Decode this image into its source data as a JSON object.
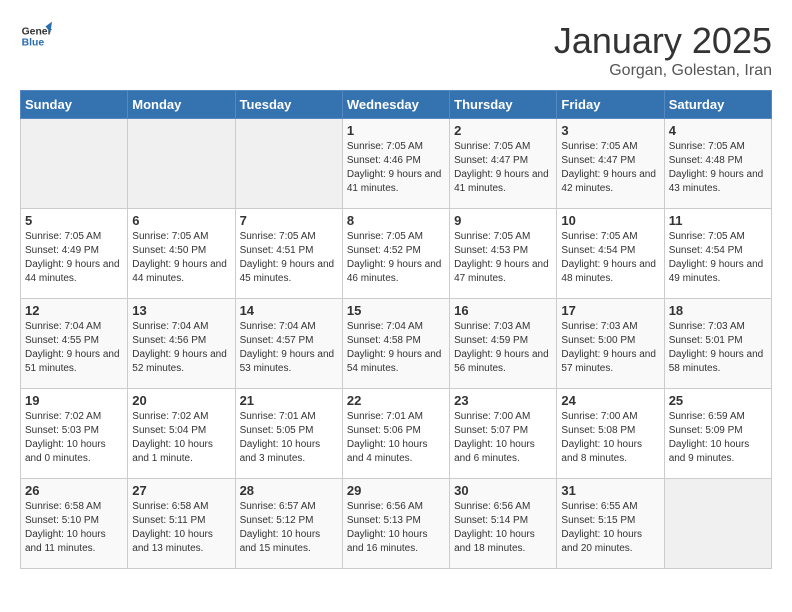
{
  "header": {
    "logo_general": "General",
    "logo_blue": "Blue",
    "title": "January 2025",
    "subtitle": "Gorgan, Golestan, Iran"
  },
  "days_of_week": [
    "Sunday",
    "Monday",
    "Tuesday",
    "Wednesday",
    "Thursday",
    "Friday",
    "Saturday"
  ],
  "weeks": [
    [
      {
        "day": "",
        "empty": true
      },
      {
        "day": "",
        "empty": true
      },
      {
        "day": "",
        "empty": true
      },
      {
        "day": "1",
        "sunrise": "7:05 AM",
        "sunset": "4:46 PM",
        "daylight": "9 hours and 41 minutes."
      },
      {
        "day": "2",
        "sunrise": "7:05 AM",
        "sunset": "4:47 PM",
        "daylight": "9 hours and 41 minutes."
      },
      {
        "day": "3",
        "sunrise": "7:05 AM",
        "sunset": "4:47 PM",
        "daylight": "9 hours and 42 minutes."
      },
      {
        "day": "4",
        "sunrise": "7:05 AM",
        "sunset": "4:48 PM",
        "daylight": "9 hours and 43 minutes."
      }
    ],
    [
      {
        "day": "5",
        "sunrise": "7:05 AM",
        "sunset": "4:49 PM",
        "daylight": "9 hours and 44 minutes."
      },
      {
        "day": "6",
        "sunrise": "7:05 AM",
        "sunset": "4:50 PM",
        "daylight": "9 hours and 44 minutes."
      },
      {
        "day": "7",
        "sunrise": "7:05 AM",
        "sunset": "4:51 PM",
        "daylight": "9 hours and 45 minutes."
      },
      {
        "day": "8",
        "sunrise": "7:05 AM",
        "sunset": "4:52 PM",
        "daylight": "9 hours and 46 minutes."
      },
      {
        "day": "9",
        "sunrise": "7:05 AM",
        "sunset": "4:53 PM",
        "daylight": "9 hours and 47 minutes."
      },
      {
        "day": "10",
        "sunrise": "7:05 AM",
        "sunset": "4:54 PM",
        "daylight": "9 hours and 48 minutes."
      },
      {
        "day": "11",
        "sunrise": "7:05 AM",
        "sunset": "4:54 PM",
        "daylight": "9 hours and 49 minutes."
      }
    ],
    [
      {
        "day": "12",
        "sunrise": "7:04 AM",
        "sunset": "4:55 PM",
        "daylight": "9 hours and 51 minutes."
      },
      {
        "day": "13",
        "sunrise": "7:04 AM",
        "sunset": "4:56 PM",
        "daylight": "9 hours and 52 minutes."
      },
      {
        "day": "14",
        "sunrise": "7:04 AM",
        "sunset": "4:57 PM",
        "daylight": "9 hours and 53 minutes."
      },
      {
        "day": "15",
        "sunrise": "7:04 AM",
        "sunset": "4:58 PM",
        "daylight": "9 hours and 54 minutes."
      },
      {
        "day": "16",
        "sunrise": "7:03 AM",
        "sunset": "4:59 PM",
        "daylight": "9 hours and 56 minutes."
      },
      {
        "day": "17",
        "sunrise": "7:03 AM",
        "sunset": "5:00 PM",
        "daylight": "9 hours and 57 minutes."
      },
      {
        "day": "18",
        "sunrise": "7:03 AM",
        "sunset": "5:01 PM",
        "daylight": "9 hours and 58 minutes."
      }
    ],
    [
      {
        "day": "19",
        "sunrise": "7:02 AM",
        "sunset": "5:03 PM",
        "daylight": "10 hours and 0 minutes."
      },
      {
        "day": "20",
        "sunrise": "7:02 AM",
        "sunset": "5:04 PM",
        "daylight": "10 hours and 1 minute."
      },
      {
        "day": "21",
        "sunrise": "7:01 AM",
        "sunset": "5:05 PM",
        "daylight": "10 hours and 3 minutes."
      },
      {
        "day": "22",
        "sunrise": "7:01 AM",
        "sunset": "5:06 PM",
        "daylight": "10 hours and 4 minutes."
      },
      {
        "day": "23",
        "sunrise": "7:00 AM",
        "sunset": "5:07 PM",
        "daylight": "10 hours and 6 minutes."
      },
      {
        "day": "24",
        "sunrise": "7:00 AM",
        "sunset": "5:08 PM",
        "daylight": "10 hours and 8 minutes."
      },
      {
        "day": "25",
        "sunrise": "6:59 AM",
        "sunset": "5:09 PM",
        "daylight": "10 hours and 9 minutes."
      }
    ],
    [
      {
        "day": "26",
        "sunrise": "6:58 AM",
        "sunset": "5:10 PM",
        "daylight": "10 hours and 11 minutes."
      },
      {
        "day": "27",
        "sunrise": "6:58 AM",
        "sunset": "5:11 PM",
        "daylight": "10 hours and 13 minutes."
      },
      {
        "day": "28",
        "sunrise": "6:57 AM",
        "sunset": "5:12 PM",
        "daylight": "10 hours and 15 minutes."
      },
      {
        "day": "29",
        "sunrise": "6:56 AM",
        "sunset": "5:13 PM",
        "daylight": "10 hours and 16 minutes."
      },
      {
        "day": "30",
        "sunrise": "6:56 AM",
        "sunset": "5:14 PM",
        "daylight": "10 hours and 18 minutes."
      },
      {
        "day": "31",
        "sunrise": "6:55 AM",
        "sunset": "5:15 PM",
        "daylight": "10 hours and 20 minutes."
      },
      {
        "day": "",
        "empty": true
      }
    ]
  ],
  "labels": {
    "sunrise": "Sunrise:",
    "sunset": "Sunset:",
    "daylight": "Daylight:"
  }
}
